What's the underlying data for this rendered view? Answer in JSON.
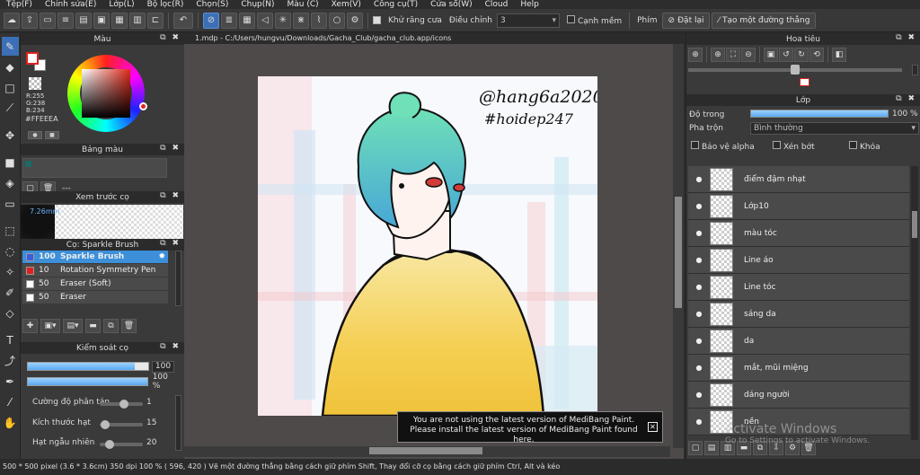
{
  "menu": [
    "Tệp(F)",
    "Chỉnh sửa(E)",
    "Lớp(L)",
    "Bộ lọc(R)",
    "Chọn(S)",
    "Chụp(N)",
    "Màu (C)",
    "Xem(V)",
    "Công cụ(T)",
    "Cửa sổ(W)",
    "Cloud",
    "Help"
  ],
  "toolbar": {
    "antialias_label": "Khử răng cưa",
    "adjust_label": "Điều chỉnh",
    "adjust_value": "3",
    "sharp_label": "Cạnh mềm",
    "key_label": "Phím",
    "reset_label": "Đặt lại",
    "straight_label": "Tạo một đường thẳng"
  },
  "left": {
    "color_title": "Màu",
    "rgb": [
      "R:255",
      "G:238",
      "B:234"
    ],
    "hex": "#FFEEEA",
    "palette_title": "Bảng màu",
    "palette_name": "---",
    "preview_title": "Xem trước cọ",
    "preview_size": "7.26mm",
    "brush_title": "Cọ: Sparkle Brush",
    "brushes": [
      {
        "size": "100",
        "name": "Sparkle Brush",
        "color": "#3c5fe0"
      },
      {
        "size": "10",
        "name": "Rotation Symmetry Pen",
        "color": "#e02020"
      },
      {
        "size": "50",
        "name": "Eraser (Soft)",
        "color": "#ffffff"
      },
      {
        "size": "50",
        "name": "Eraser",
        "color": "#ffffff"
      }
    ],
    "control_title": "Kiểm soát cọ",
    "brush_size": "100",
    "brush_opacity": "100 %",
    "sliders": [
      {
        "label": "Cường độ phân tán",
        "value": "1"
      },
      {
        "label": "Kích thước hạt",
        "value": "15"
      },
      {
        "label": "Hạt ngẫu nhiên",
        "value": "20"
      }
    ]
  },
  "canvas": {
    "tab": "1.mdp - C:/Users/hungvu/Downloads/Gacha_Club/gacha_club.app/icons",
    "signature1": "@hang6a2020",
    "signature2": "#hoidep247",
    "notice_line1": "You are not using the latest version of MediBang Paint.",
    "notice_line2": "Please install the latest version of MediBang Paint found here."
  },
  "right": {
    "navigator_title": "Hoa tiêu",
    "layer_title": "Lớp",
    "opacity_label": "Độ trong",
    "opacity_value": "100 %",
    "blend_label": "Pha trộn",
    "blend_value": "Bình thường",
    "protect_alpha": "Bảo vệ alpha",
    "clip": "Xén bớt",
    "lock": "Khóa",
    "layers": [
      "điểm đậm nhạt",
      "Lớp10",
      "màu tóc",
      "Line áo",
      "Line tóc",
      "sáng da",
      "da",
      "mắt, mũi miệng",
      "dáng người",
      "nền"
    ],
    "watermark_line1": "Activate Windows",
    "watermark_line2": "Go to Settings to activate Windows."
  },
  "status": "500 * 500 pixel   (3.6 * 3.6cm)   350 dpi   100 %   ( 596, 420 )   Vẽ một đường thẳng bằng cách giữ phím Shift, Thay đổi cỡ cọ bằng cách giữ phím Ctrl, Alt và kéo",
  "colors": {
    "accent": "#3c6fb5",
    "selection": "#3c8fd8",
    "fg_swatch": "#ffffff"
  }
}
